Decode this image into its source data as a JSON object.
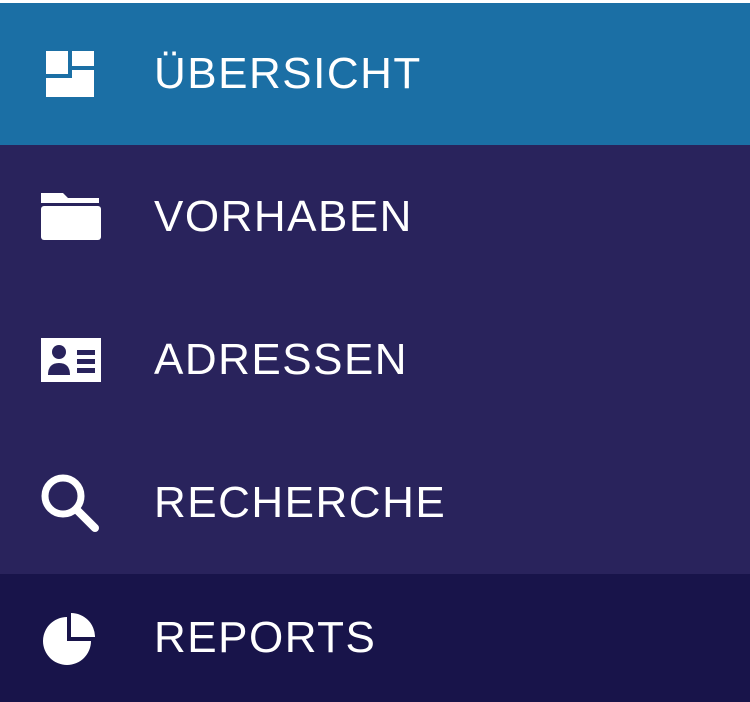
{
  "colors": {
    "active_bg": "#1b6fa5",
    "default_bg": "#29235c",
    "dark_bg": "#18144a",
    "text": "#ffffff"
  },
  "nav": {
    "items": [
      {
        "label": "ÜBERSICHT",
        "icon": "dashboard-icon",
        "state": "active"
      },
      {
        "label": "VORHABEN",
        "icon": "folder-icon",
        "state": "default"
      },
      {
        "label": "ADRESSEN",
        "icon": "contact-card-icon",
        "state": "default"
      },
      {
        "label": "RECHERCHE",
        "icon": "search-icon",
        "state": "default"
      },
      {
        "label": "REPORTS",
        "icon": "pie-chart-icon",
        "state": "dark"
      }
    ]
  }
}
